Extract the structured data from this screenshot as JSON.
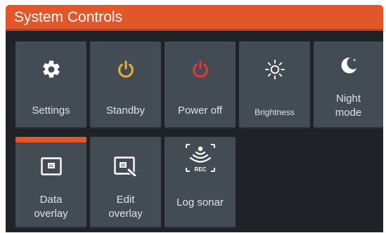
{
  "window": {
    "title": "System Controls"
  },
  "tiles": [
    {
      "name": "settings",
      "label": "Settings",
      "icon": "gear-icon"
    },
    {
      "name": "standby",
      "label": "Standby",
      "icon": "standby-power-icon",
      "color": "#e6b422"
    },
    {
      "name": "power-off",
      "label": "Power off",
      "icon": "power-off-icon",
      "color": "#e53935"
    },
    {
      "name": "brightness",
      "label": "Brightness",
      "icon": "sun-brightness-icon"
    },
    {
      "name": "night-mode",
      "label_line1": "Night",
      "label_line2": "mode",
      "icon": "moon-icon"
    },
    {
      "name": "data-overlay",
      "label_line1": "Data",
      "label_line2": "overlay",
      "icon": "data-overlay-icon",
      "active": true
    },
    {
      "name": "edit-overlay",
      "label_line1": "Edit",
      "label_line2": "overlay",
      "icon": "edit-overlay-icon"
    },
    {
      "name": "log-sonar",
      "label": "Log sonar",
      "icon": "sonar-record-icon",
      "icon_text": "REC"
    }
  ],
  "colors": {
    "accent": "#e2572a",
    "panel": "#1f2327",
    "tile": "#434c54",
    "standby": "#e6b422",
    "power_off": "#e53935"
  }
}
